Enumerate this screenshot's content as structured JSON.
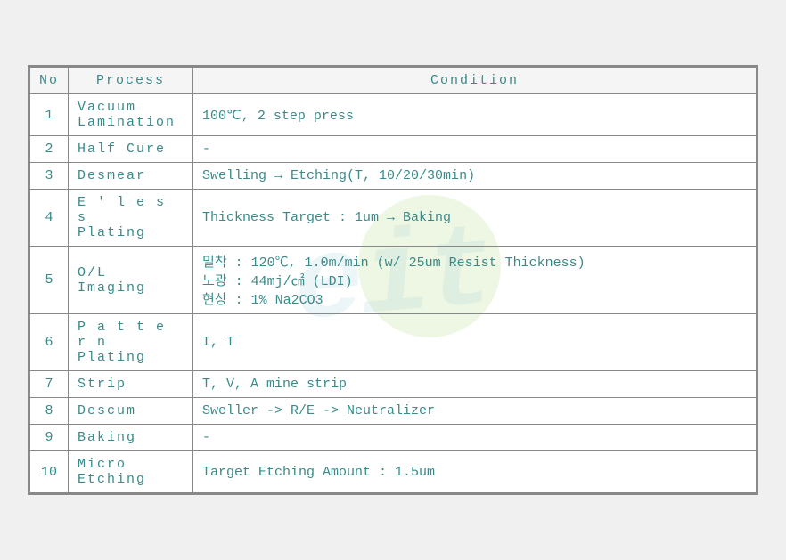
{
  "table": {
    "headers": [
      "No",
      "Process",
      "Condition"
    ],
    "rows": [
      {
        "no": "1",
        "process": "Vacuum\nLamination",
        "condition": "100℃, 2 step press"
      },
      {
        "no": "2",
        "process": "Half Cure",
        "condition": "-"
      },
      {
        "no": "3",
        "process": "Desmear",
        "condition": "Swelling → Etching(T, 10/20/30min)"
      },
      {
        "no": "4",
        "process": "E ' l e s s\nPlating",
        "condition": "Thickness Target : 1um → Baking"
      },
      {
        "no": "5",
        "process": "O/L Imaging",
        "condition": "밀착 : 120℃, 1.0m/min (w/ 25um Resist Thickness)\n노광 : 44mj/㎠ (LDI)\n현상 : 1% Na2CO3"
      },
      {
        "no": "6",
        "process": "P a t t e r n\nPlating",
        "condition": "I, T"
      },
      {
        "no": "7",
        "process": "Strip",
        "condition": "T, V, A mine strip"
      },
      {
        "no": "8",
        "process": "Descum",
        "condition": "Sweller -> R/E -> Neutralizer"
      },
      {
        "no": "9",
        "process": "Baking",
        "condition": "-"
      },
      {
        "no": "10",
        "process": "Micro Etching",
        "condition": "Target Etching Amount : 1.5um"
      }
    ],
    "watermark": "eit"
  }
}
